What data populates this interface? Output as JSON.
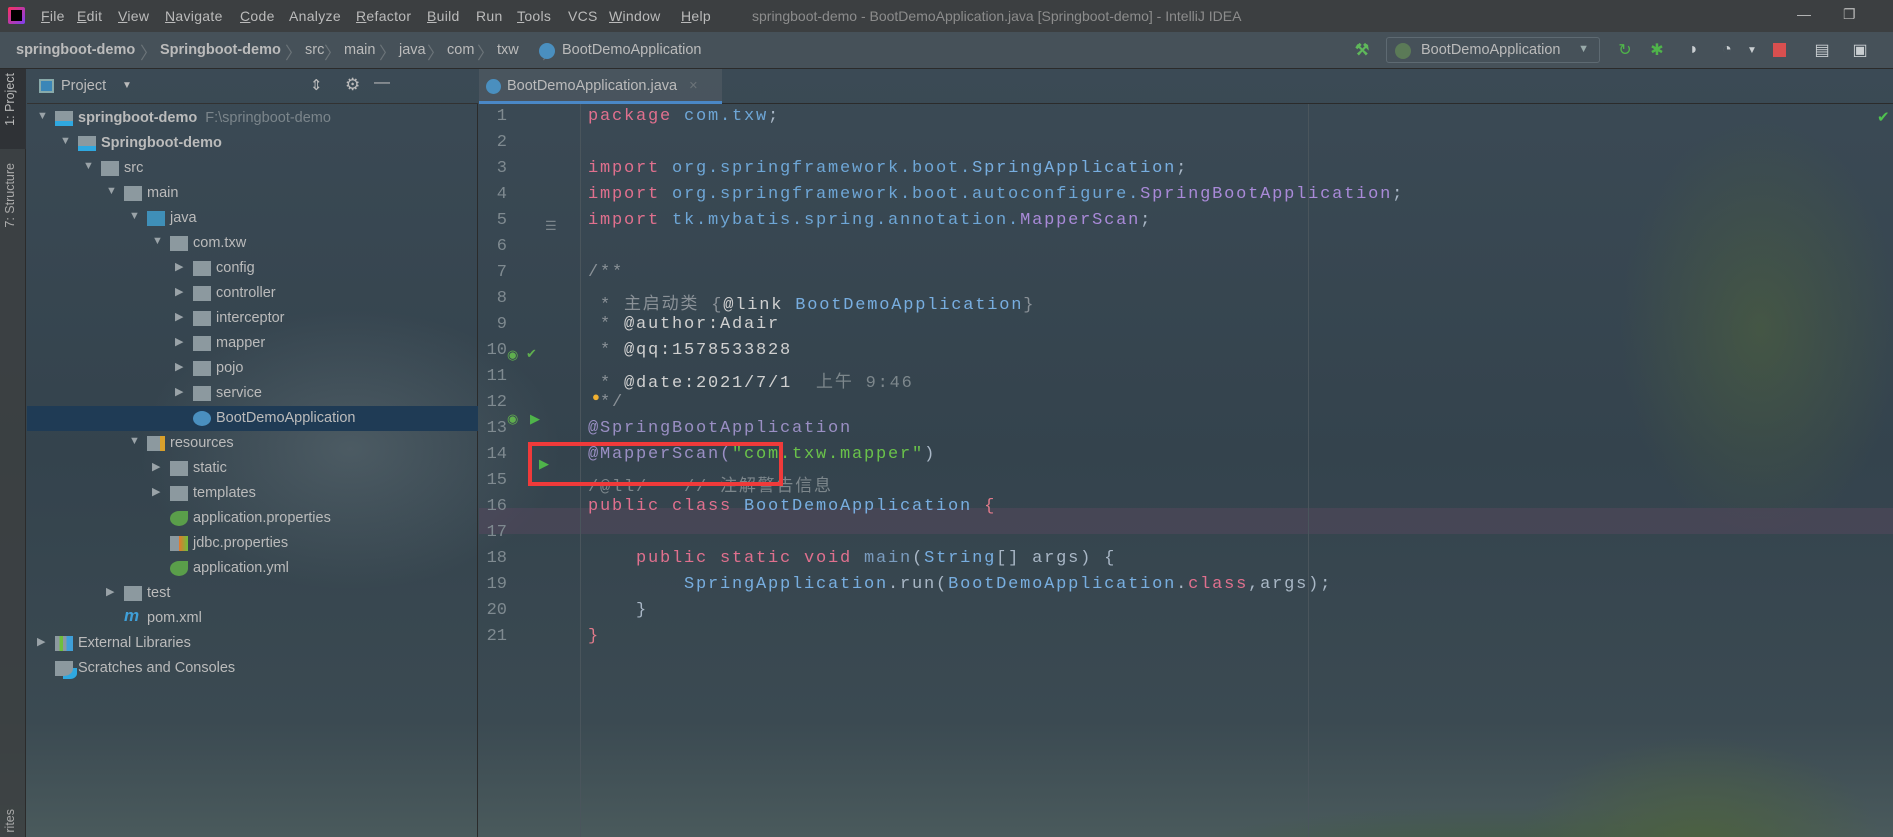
{
  "menubar": {
    "items": [
      {
        "label": "File",
        "u": "F",
        "rest": "ile"
      },
      {
        "label": "Edit",
        "u": "E",
        "rest": "dit"
      },
      {
        "label": "View",
        "u": "V",
        "rest": "iew"
      },
      {
        "label": "Navigate",
        "u": "N",
        "rest": "avigate"
      },
      {
        "label": "Code",
        "u": "C",
        "rest": "ode"
      },
      {
        "label": "Analyze",
        "u": "",
        "rest": "Analyze"
      },
      {
        "label": "Refactor",
        "u": "R",
        "rest": "efactor"
      },
      {
        "label": "Build",
        "u": "B",
        "rest": "uild"
      },
      {
        "label": "Run",
        "u": "",
        "rest": "Run"
      },
      {
        "label": "Tools",
        "u": "T",
        "rest": "ools"
      },
      {
        "label": "VCS",
        "u": "",
        "rest": "VCS"
      },
      {
        "label": "Window",
        "u": "W",
        "rest": "indow"
      },
      {
        "label": "Help",
        "u": "H",
        "rest": "elp"
      }
    ],
    "title": "springboot-demo - BootDemoApplication.java [Springboot-demo] - IntelliJ IDEA"
  },
  "breadcrumb": [
    "springboot-demo",
    "Springboot-demo",
    "src",
    "main",
    "java",
    "com",
    "txw",
    "BootDemoApplication"
  ],
  "toolbar": {
    "run_config": "BootDemoApplication",
    "icons": [
      "build-hammer-icon",
      "rerun-icon",
      "debug-icon",
      "coverage-icon",
      "profiler-icon",
      "stop-icon",
      "project-structure-icon",
      "run-window-icon"
    ]
  },
  "colors": {
    "accent": "#4a88c7",
    "selection": "#1f3b55",
    "highlight_box": "#f03a3a"
  },
  "tool_windows": {
    "project": "1: Project",
    "structure": "7: Structure",
    "favorites": "rites"
  },
  "project_panel": {
    "title": "Project",
    "tree": [
      {
        "label": "springboot-demo",
        "hint": "F:\\springboot-demo",
        "level": 0,
        "arrow": "open",
        "icon": "module",
        "bold": true
      },
      {
        "label": "Springboot-demo",
        "level": 1,
        "arrow": "open",
        "icon": "module",
        "bold": true
      },
      {
        "label": "src",
        "level": 2,
        "arrow": "open",
        "icon": "folder"
      },
      {
        "label": "main",
        "level": 3,
        "arrow": "open",
        "icon": "folder"
      },
      {
        "label": "java",
        "level": 4,
        "arrow": "open",
        "icon": "source-folder"
      },
      {
        "label": "com.txw",
        "level": 5,
        "arrow": "open",
        "icon": "package"
      },
      {
        "label": "config",
        "level": 6,
        "arrow": "closed",
        "icon": "package"
      },
      {
        "label": "controller",
        "level": 6,
        "arrow": "closed",
        "icon": "package"
      },
      {
        "label": "interceptor",
        "level": 6,
        "arrow": "closed",
        "icon": "package"
      },
      {
        "label": "mapper",
        "level": 6,
        "arrow": "closed",
        "icon": "package"
      },
      {
        "label": "pojo",
        "level": 6,
        "arrow": "closed",
        "icon": "package"
      },
      {
        "label": "service",
        "level": 6,
        "arrow": "closed",
        "icon": "package"
      },
      {
        "label": "BootDemoApplication",
        "level": 6,
        "arrow": "none",
        "icon": "spring-class",
        "selected": true
      },
      {
        "label": "resources",
        "level": 4,
        "arrow": "open",
        "icon": "resources-folder"
      },
      {
        "label": "static",
        "level": 5,
        "arrow": "closed",
        "icon": "folder"
      },
      {
        "label": "templates",
        "level": 5,
        "arrow": "closed",
        "icon": "folder"
      },
      {
        "label": "application.properties",
        "level": 5,
        "arrow": "none",
        "icon": "spring-config"
      },
      {
        "label": "jdbc.properties",
        "level": 5,
        "arrow": "none",
        "icon": "properties"
      },
      {
        "label": "application.yml",
        "level": 5,
        "arrow": "none",
        "icon": "spring-config"
      },
      {
        "label": "test",
        "level": 3,
        "arrow": "closed",
        "icon": "folder"
      },
      {
        "label": "pom.xml",
        "level": 3,
        "arrow": "none",
        "icon": "maven"
      },
      {
        "label": "External Libraries",
        "level": 0,
        "arrow": "closed",
        "icon": "libraries"
      },
      {
        "label": "Scratches and Consoles",
        "level": 0,
        "arrow": "none",
        "icon": "scratches"
      }
    ]
  },
  "editor": {
    "tab": "BootDemoApplication.java",
    "current_line": 16,
    "lines": [
      [
        [
          "package ",
          "kw"
        ],
        [
          "com.txw",
          "pk"
        ],
        [
          ";",
          "df"
        ]
      ],
      [],
      [
        [
          "import ",
          "kw"
        ],
        [
          "org.springframework.boot.",
          "pk"
        ],
        [
          "SpringApplication",
          "cl"
        ],
        [
          ";",
          "df"
        ]
      ],
      [
        [
          "import ",
          "kw"
        ],
        [
          "org.springframework.boot.autoconfigure.",
          "pk"
        ],
        [
          "SpringBootApplication",
          "ip"
        ],
        [
          ";",
          "df"
        ]
      ],
      [
        [
          "import ",
          "kw"
        ],
        [
          "tk.mybatis.spring.annotation.",
          "pk"
        ],
        [
          "MapperScan",
          "ip"
        ],
        [
          ";",
          "df"
        ]
      ],
      [],
      [
        [
          "/**",
          "cm"
        ]
      ],
      [
        [
          " * 主启动类 {",
          "cm"
        ],
        [
          "@link ",
          "doc"
        ],
        [
          "BootDemoApplication",
          "cl"
        ],
        [
          "}",
          "cm"
        ]
      ],
      [
        [
          " * ",
          "cm"
        ],
        [
          "@author:Adair",
          "doc"
        ]
      ],
      [
        [
          " * ",
          "cm"
        ],
        [
          "@qq:1578533828",
          "doc"
        ]
      ],
      [
        [
          " * ",
          "cm"
        ],
        [
          "@date:2021/7/1",
          "doc"
        ],
        [
          "  上午 9:46",
          "cn"
        ]
      ],
      [
        [
          " */",
          "cm"
        ]
      ],
      [
        [
          "@SpringBootApplication",
          "an"
        ]
      ],
      [
        [
          "@MapperScan(",
          "an"
        ],
        [
          "\"com.txw.mapper\"",
          "st"
        ],
        [
          ")",
          "df"
        ]
      ],
      [
        [
          "/@ll/   // 注解警告信息",
          "cn"
        ]
      ],
      [
        [
          "public class ",
          "kw"
        ],
        [
          "BootDemoApplication ",
          "cl"
        ],
        [
          "{",
          "br"
        ]
      ],
      [],
      [
        [
          "    public static void ",
          "kw"
        ],
        [
          "main",
          "fn"
        ],
        [
          "(",
          "df"
        ],
        [
          "String",
          "cl"
        ],
        [
          "[] args) {",
          "df"
        ]
      ],
      [
        [
          "        SpringApplication",
          "cl"
        ],
        [
          ".run(",
          "df"
        ],
        [
          "BootDemoApplication",
          "cl"
        ],
        [
          ".",
          "df"
        ],
        [
          "class",
          "kw"
        ],
        [
          ",args);",
          "df"
        ]
      ],
      [
        [
          "    }",
          "df"
        ]
      ],
      [
        [
          "}",
          "br"
        ]
      ]
    ]
  }
}
